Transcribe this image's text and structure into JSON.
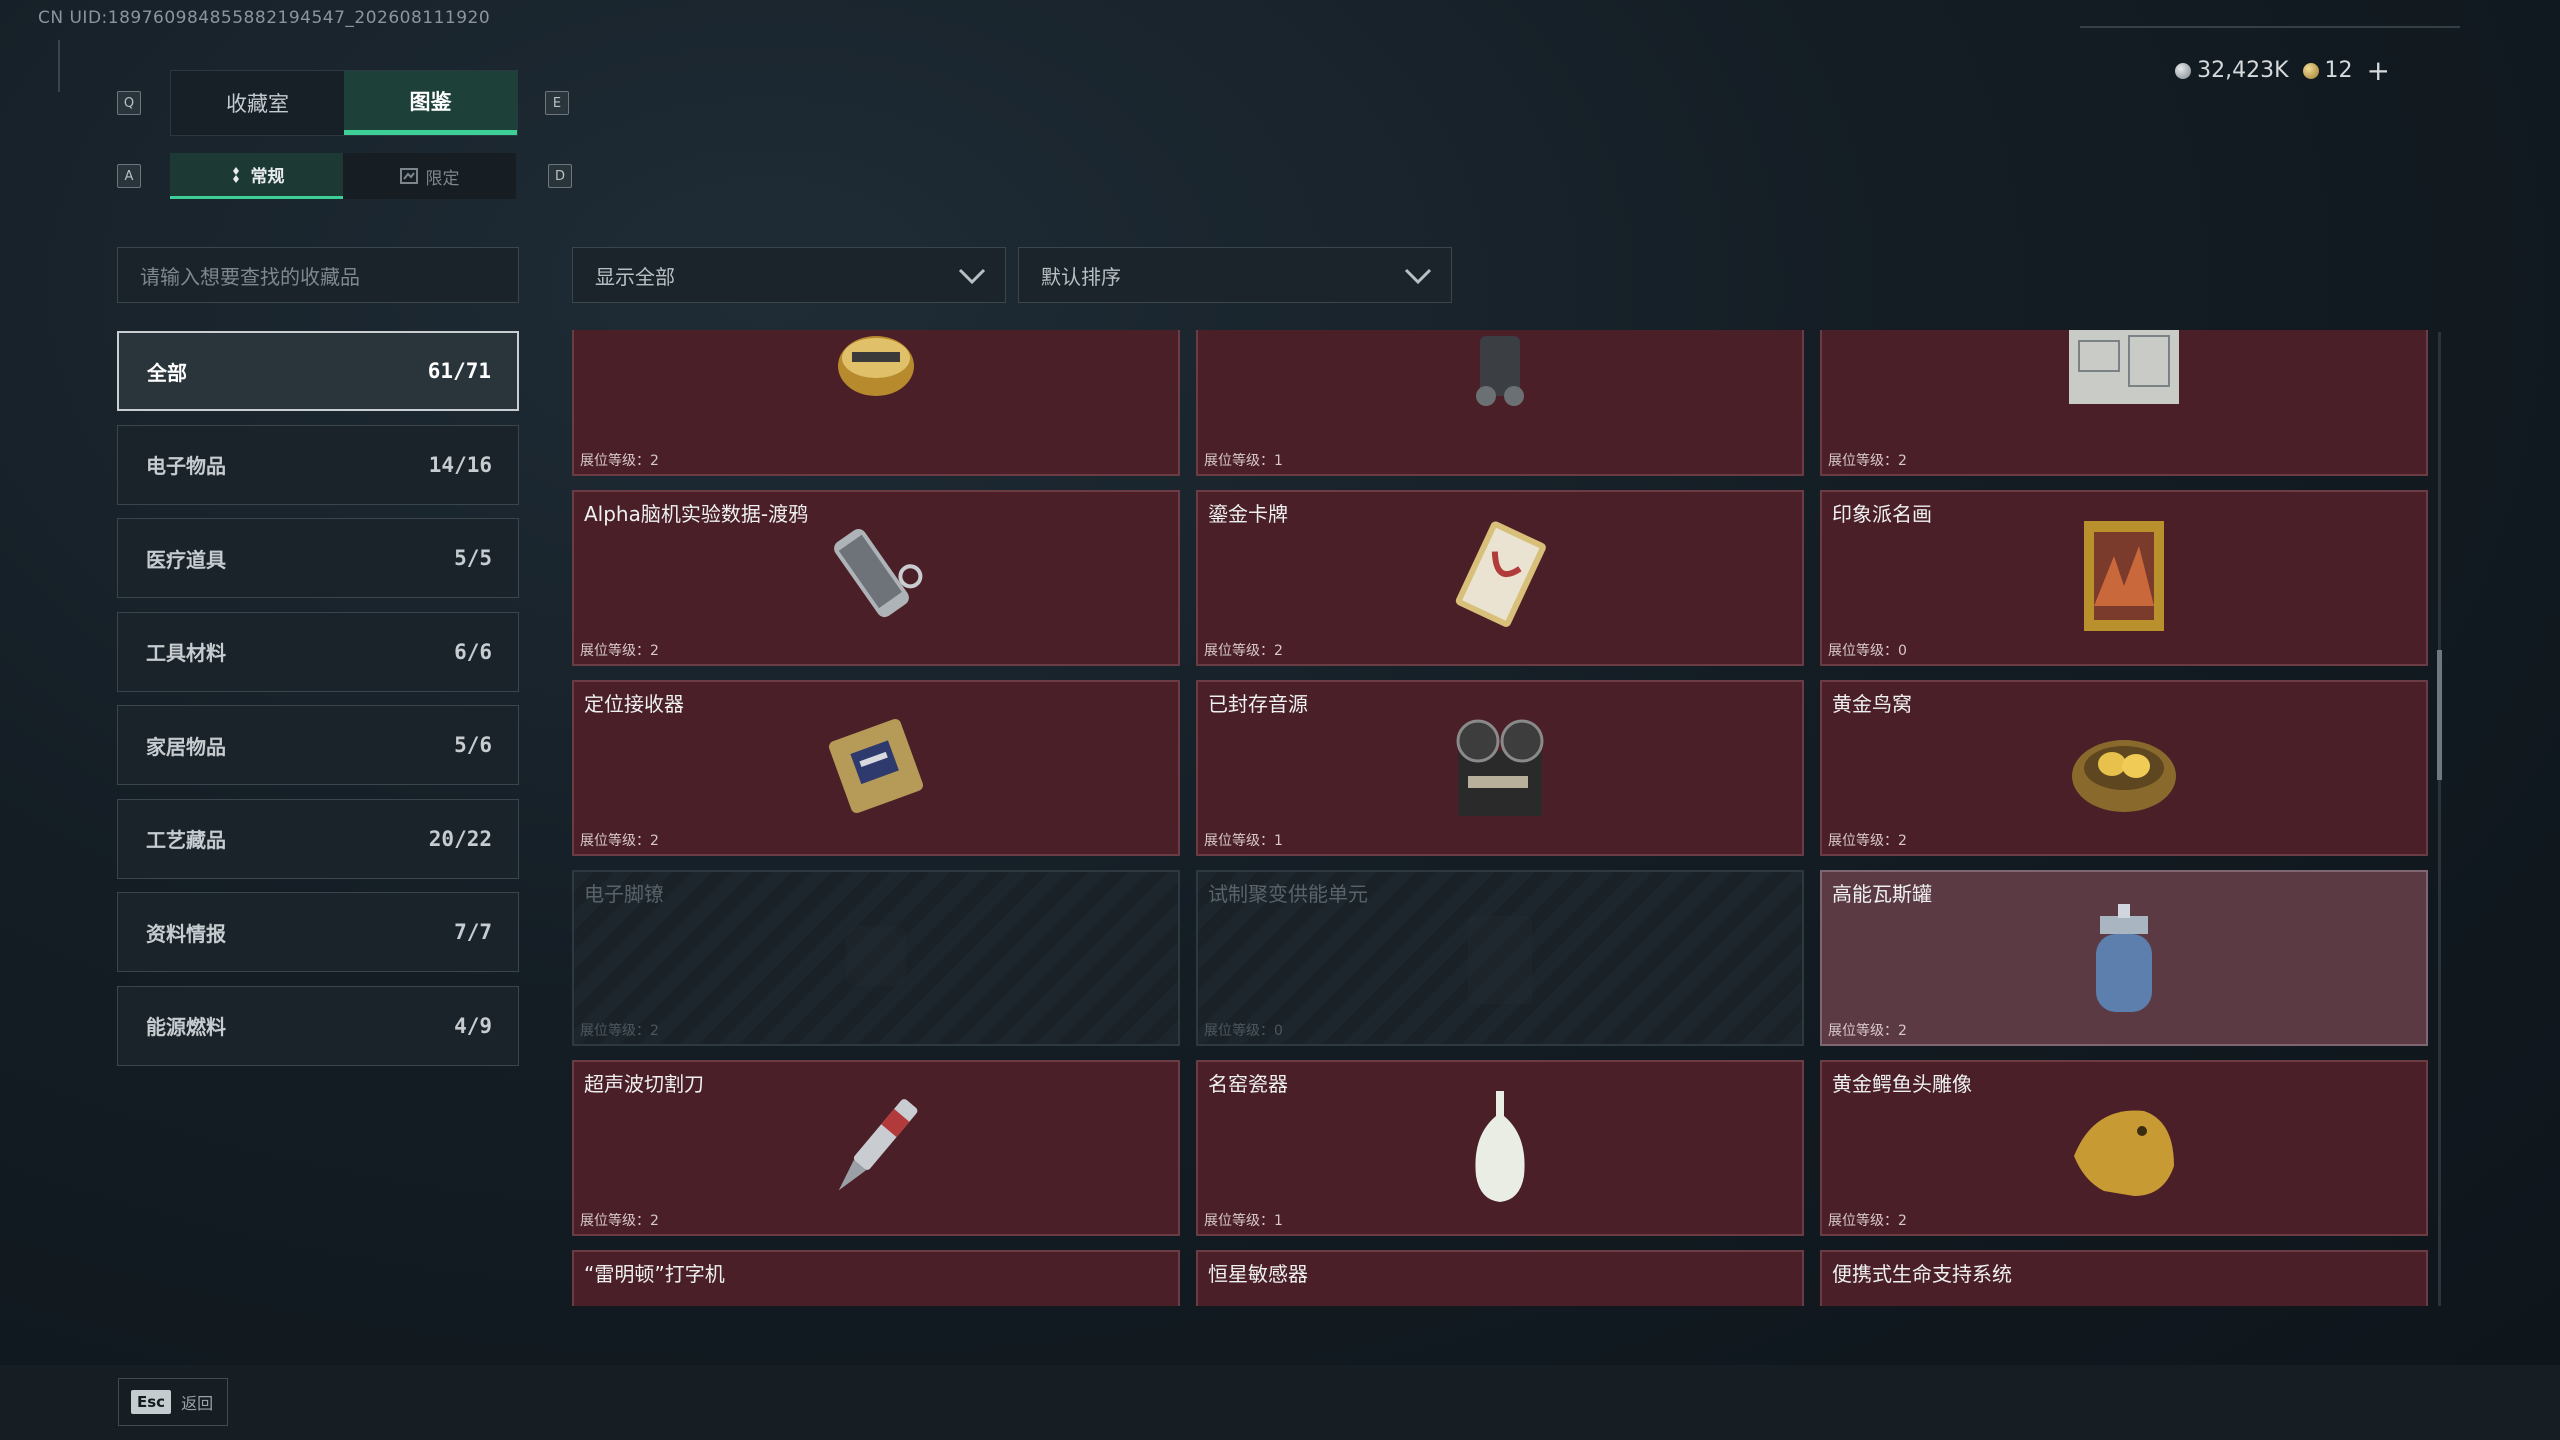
{
  "uid_text": "CN UID:1897609848558821945​47_202608111920",
  "keys": {
    "prev_tab": "Q",
    "next_tab": "E",
    "prev_sub": "A",
    "next_sub": "D"
  },
  "tabs": [
    {
      "label": "收藏室",
      "active": false
    },
    {
      "label": "图鉴",
      "active": true
    }
  ],
  "subtabs": [
    {
      "label": "常规",
      "active": true
    },
    {
      "label": "限定",
      "active": false
    }
  ],
  "currency": {
    "silver": "32,423K",
    "gold": "12",
    "plus": "+"
  },
  "search": {
    "placeholder": "请输入想要查找的收藏品"
  },
  "filters": {
    "show": "显示全部",
    "sort": "默认排序"
  },
  "categories": [
    {
      "label": "全部",
      "count": "61/71",
      "active": true
    },
    {
      "label": "电子物品",
      "count": "14/16",
      "active": false
    },
    {
      "label": "医疗道具",
      "count": "5/5",
      "active": false
    },
    {
      "label": "工具材料",
      "count": "6/6",
      "active": false
    },
    {
      "label": "家居物品",
      "count": "5/6",
      "active": false
    },
    {
      "label": "工艺藏品",
      "count": "20/22",
      "active": false
    },
    {
      "label": "资料情报",
      "count": "7/7",
      "active": false
    },
    {
      "label": "能源燃料",
      "count": "4/9",
      "active": false
    }
  ],
  "items": [
    {
      "name": "",
      "level": "展位等级：2",
      "icon": "caviar-tin-icon",
      "state": "owned"
    },
    {
      "name": "",
      "level": "展位等级：1",
      "icon": "device-icon",
      "state": "owned"
    },
    {
      "name": "",
      "level": "展位等级：2",
      "icon": "blueprint-icon",
      "state": "owned"
    },
    {
      "name": "Alpha脑机实验数据-渡鸦",
      "level": "展位等级：2",
      "icon": "flash-drive-icon",
      "state": "owned"
    },
    {
      "name": "鎏金卡牌",
      "level": "展位等级：2",
      "icon": "gilded-card-icon",
      "state": "owned"
    },
    {
      "name": "印象派名画",
      "level": "展位等级：0",
      "icon": "painting-icon",
      "state": "owned"
    },
    {
      "name": "定位接收器",
      "level": "展位等级：2",
      "icon": "receiver-icon",
      "state": "owned"
    },
    {
      "name": "已封存音源",
      "level": "展位等级：1",
      "icon": "reel-recorder-icon",
      "state": "owned"
    },
    {
      "name": "黄金鸟窝",
      "level": "展位等级：2",
      "icon": "golden-nest-icon",
      "state": "owned"
    },
    {
      "name": "电子脚镣",
      "level": "展位等级：2",
      "icon": "ankle-monitor-icon",
      "state": "locked"
    },
    {
      "name": "试制聚变供能单元",
      "level": "展位等级：0",
      "icon": "fusion-unit-icon",
      "state": "locked"
    },
    {
      "name": "高能瓦斯罐",
      "level": "展位等级：2",
      "icon": "gas-canister-icon",
      "state": "highlight"
    },
    {
      "name": "超声波切割刀",
      "level": "展位等级：2",
      "icon": "ultrasonic-cutter-icon",
      "state": "owned"
    },
    {
      "name": "名窑瓷器",
      "level": "展位等级：1",
      "icon": "porcelain-vase-icon",
      "state": "owned"
    },
    {
      "name": "黄金鳄鱼头雕像",
      "level": "展位等级：2",
      "icon": "gold-crocodile-icon",
      "state": "owned"
    },
    {
      "name": "“雷明顿”打字机",
      "level": "",
      "icon": "typewriter-icon",
      "state": "owned"
    },
    {
      "name": "恒星敏感器",
      "level": "",
      "icon": "star-sensor-icon",
      "state": "owned"
    },
    {
      "name": "便携式生命支持系统",
      "level": "",
      "icon": "life-support-icon",
      "state": "owned"
    }
  ],
  "footer": {
    "esc_key": "Esc",
    "esc_label": "返回"
  }
}
